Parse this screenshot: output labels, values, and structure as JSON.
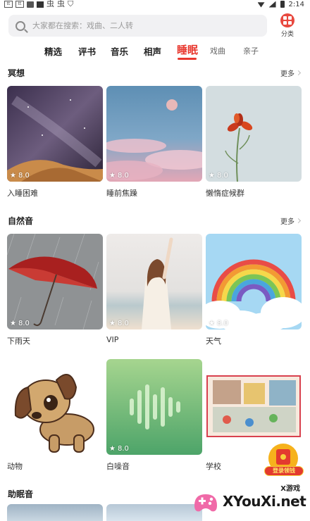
{
  "status_bar": {
    "time": "2:14",
    "left_icons": [
      "tt",
      "tt",
      "image",
      "square",
      "虫",
      "虫",
      "shield"
    ]
  },
  "search": {
    "placeholder": "大家都在搜索：戏曲、二人转"
  },
  "category": {
    "label": "分类",
    "icon": "grid-icon",
    "color": "#e8493f"
  },
  "tabs": [
    {
      "label": "精选"
    },
    {
      "label": "评书"
    },
    {
      "label": "音乐"
    },
    {
      "label": "相声"
    },
    {
      "label": "睡眠",
      "active": true
    },
    {
      "label": "戏曲"
    },
    {
      "label": "亲子"
    }
  ],
  "accent_color": "#e8372e",
  "sections": [
    {
      "title": "冥想",
      "more": "更多",
      "items": [
        {
          "title": "入睡困难",
          "rating": "8.0"
        },
        {
          "title": "睡前焦躁",
          "rating": "8.0"
        },
        {
          "title": "懒惰症候群",
          "rating": "8.0"
        }
      ]
    },
    {
      "title": "自然音",
      "more": "更多",
      "items": [
        {
          "title": "下雨天",
          "rating": "8.0"
        },
        {
          "title": "VIP",
          "rating": "8.0"
        },
        {
          "title": "天气",
          "rating": "8.0"
        },
        {
          "title": "动物",
          "rating": ""
        },
        {
          "title": "白噪音",
          "rating": "8.0"
        },
        {
          "title": "学校",
          "rating": ""
        }
      ]
    },
    {
      "title": "助眠音"
    }
  ],
  "login_badge": {
    "label": "登录领钱"
  },
  "watermark": {
    "small": "X游戏",
    "big": "XYouXi.net"
  }
}
